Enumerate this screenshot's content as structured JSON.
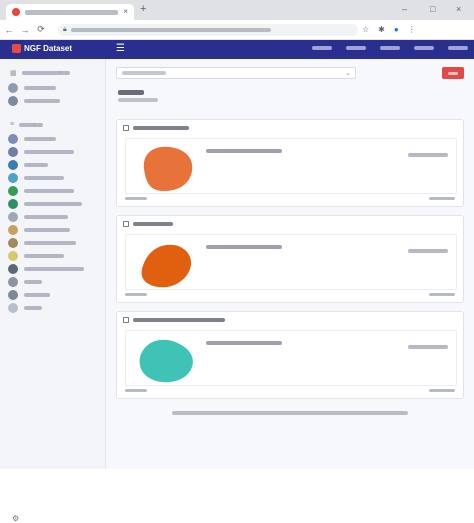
{
  "browser": {
    "tab_title": "",
    "tab_close": "×",
    "new_tab": "+",
    "window_controls": [
      "–",
      "□",
      "×"
    ],
    "nav": [
      "←",
      "→",
      "⟳"
    ],
    "url": "",
    "lock_icon": "lock-icon",
    "toolbar_icons": [
      "star-icon",
      "extension-icon",
      "profile-icon",
      "menu-icon"
    ]
  },
  "app": {
    "brand": "NGF Dataset",
    "menu_icon": "☰",
    "top_nav": [
      "",
      "",
      "",
      "",
      ""
    ]
  },
  "sidebar": {
    "section1_label": "",
    "section1_items": [
      {
        "label": "",
        "color": "#8e9bb0"
      },
      {
        "label": "",
        "color": "#7c8aa0"
      }
    ],
    "section2_label": "",
    "section2_items": [
      {
        "label": "",
        "color": "#7b8db8"
      },
      {
        "label": "",
        "color": "#6f7fa8"
      },
      {
        "label": "",
        "color": "#3b7bb5"
      },
      {
        "label": "",
        "color": "#4aa3c9"
      },
      {
        "label": "",
        "color": "#3a9a5a"
      },
      {
        "label": "",
        "color": "#2f8f64"
      },
      {
        "label": "",
        "color": "#a0a8b8"
      },
      {
        "label": "",
        "color": "#c9a25a"
      },
      {
        "label": "",
        "color": "#a08a5e"
      },
      {
        "label": "",
        "color": "#d7c96a"
      },
      {
        "label": "",
        "color": "#5e6675"
      },
      {
        "label": "",
        "color": "#8a93a3"
      },
      {
        "label": "",
        "color": "#7f8896"
      },
      {
        "label": "",
        "color": "#b8bec9"
      }
    ]
  },
  "main": {
    "search_placeholder": "",
    "search_button": "",
    "results_title": "",
    "results_subtitle": "",
    "cards": [
      {
        "title": "",
        "meta": "",
        "action": "",
        "footer_left": "",
        "footer_right": "",
        "shape_color": "#e8733a"
      },
      {
        "title": "",
        "meta": "",
        "action": "",
        "footer_left": "",
        "footer_right": "",
        "shape_color": "#e06010"
      },
      {
        "title": "",
        "meta": "",
        "action": "",
        "footer_left": "",
        "footer_right": "",
        "shape_color": "#3ec3b6"
      }
    ],
    "footer_note": ""
  },
  "colors": {
    "header": "#2a2f8f",
    "accent": "#e24a4a",
    "sidebar_bg": "#f4f5f9"
  }
}
